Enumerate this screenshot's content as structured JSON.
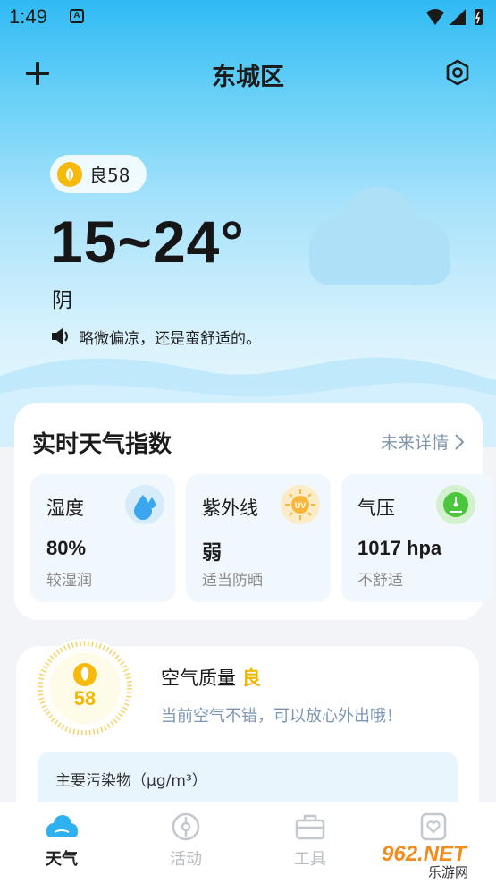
{
  "status": {
    "time": "1:49",
    "notif_badge": "A"
  },
  "header": {
    "city": "东城区",
    "add_icon": "plus-icon",
    "settings_icon": "settings-hexagon-icon"
  },
  "weather": {
    "aqi_pill": "良58",
    "temp_range": "15~24°",
    "condition": "阴",
    "tip": "略微偏凉，还是蛮舒适的。",
    "condition_icon": "cloud-icon"
  },
  "index_card": {
    "title": "实时天气指数",
    "more": "未来详情",
    "tiles": [
      {
        "label": "湿度",
        "value": "80%",
        "note": "较湿润",
        "icon": "water-drop-icon",
        "color": "#3aa6ee"
      },
      {
        "label": "紫外线",
        "value": "弱",
        "note": "适当防晒",
        "icon": "uv-sun-icon",
        "color": "#f6b73c"
      },
      {
        "label": "气压",
        "value": "1017 hpa",
        "note": "不舒适",
        "icon": "pressure-gauge-icon",
        "color": "#4cc63c"
      }
    ]
  },
  "air_card": {
    "title": "空气质量",
    "level": "良",
    "aqi": "58",
    "desc": "当前空气不错，可以放心外出哦！",
    "pollutant_title": "主要污染物（μg/m³）"
  },
  "tabs": [
    {
      "label": "天气",
      "icon": "weather-cloud-icon",
      "active": true
    },
    {
      "label": "活动",
      "icon": "compass-icon",
      "active": false
    },
    {
      "label": "工具",
      "icon": "toolbox-icon",
      "active": false
    },
    {
      "label": "",
      "icon": "heart-icon",
      "active": false
    }
  ],
  "watermark": {
    "text": "962.NET",
    "sub": "乐游网"
  },
  "colors": {
    "accent_yellow": "#f6b90c",
    "sky_blue": "#2fbaf3",
    "link_grey": "#7f96ad"
  }
}
